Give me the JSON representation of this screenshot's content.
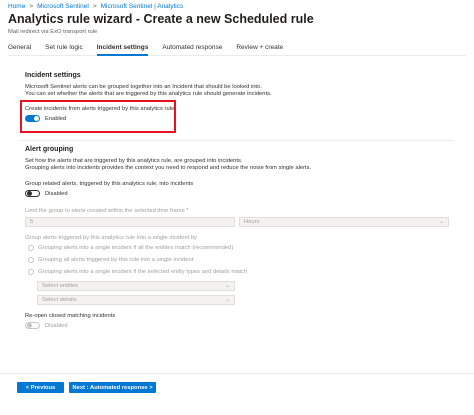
{
  "breadcrumb": {
    "items": [
      "Home",
      "Microsoft Sentinel",
      "Microsoft Sentinel | Analytics"
    ],
    "separator": ">"
  },
  "header": {
    "title": "Analytics rule wizard - Create a new Scheduled rule",
    "subtitle": "Mail redirect via ExO transport rule"
  },
  "tabs": [
    {
      "label": "General"
    },
    {
      "label": "Set rule logic"
    },
    {
      "label": "Incident settings"
    },
    {
      "label": "Automated response"
    },
    {
      "label": "Review + create"
    }
  ],
  "incident_settings": {
    "title": "Incident settings",
    "desc_line1": "Microsoft Sentinel alerts can be grouped together into an Incident that should be looked into.",
    "desc_line2": "You can set whether the alerts that are triggered by this analytics rule should generate incidents.",
    "create_label": "Create incidents from alerts triggered by this analytics rule",
    "create_state": "Enabled"
  },
  "alert_grouping": {
    "title": "Alert grouping",
    "desc_line1": "Set how the alerts that are triggered by this analytics rule, are grouped into incidents.",
    "desc_line2": "Grouping alerts into incidents provides the context you need to respond and reduce the noise from single alerts.",
    "group_label": "Group related alerts, triggered by this analytics rule, into incidents",
    "group_state": "Disabled",
    "limit_label": "Limit the group to alerts created within the selected time frame *",
    "limit_value": "5",
    "limit_unit": "Hours",
    "grouping_label": "Group alerts triggered by this analytics rule into a single incident by",
    "radio_options": [
      "Grouping alerts into a single incident if all the entities match (recommended)",
      "Grouping all alerts triggered by this rule into a single incident",
      "Grouping alerts into a single incident if the selected entity types and details match"
    ],
    "select_entities": "Select entities",
    "select_details": "Select details",
    "reopen_label": "Re-open closed matching incidents",
    "reopen_state": "Disabled"
  },
  "footer": {
    "previous_label": "< Previous",
    "next_label": "Next : Automated response >"
  }
}
